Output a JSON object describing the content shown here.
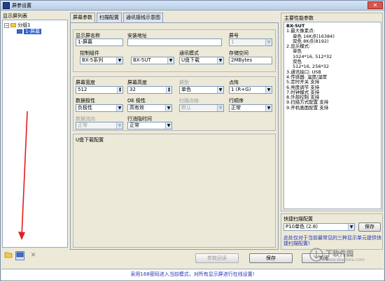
{
  "window": {
    "title": "屏参设置",
    "close_glyph": "✕"
  },
  "left_panel": {
    "title": "显示屏列表",
    "tree": [
      {
        "label": "分组1",
        "expand_glyph": "−"
      },
      {
        "label": "1-屏幕"
      }
    ],
    "tool_icons": [
      "folder-icon",
      "screen-icon",
      "delete-icon"
    ],
    "delete_glyph": "✕"
  },
  "tabs": [
    "屏幕参数",
    "扫描配置",
    "通讯接线示意图"
  ],
  "screen_params": {
    "name_label": "显示屏名称",
    "name_value": "1-屏幕",
    "install_label": "安装地址",
    "install_value": "",
    "number_label": "屏号",
    "number_value": "1",
    "controller_label": "控制组件",
    "series_value": "BX-5系列",
    "model_value": "BX-5UT",
    "comm_label": "通讯模式",
    "comm_value": "U盘下载",
    "storage_label": "存储空间",
    "storage_value": "2MBytes",
    "width_label": "屏幕宽度",
    "width_value": "512",
    "height_label": "屏幕高度",
    "height_value": "32",
    "type_label": "屏型",
    "type_value": "单色",
    "dot_label": "点阵",
    "dot_value": "1 (R+G)",
    "data_pol_label": "数据极性",
    "data_pol_value": "负极性",
    "oe_label": "OE 极性",
    "oe_value": "高有效",
    "scan_label": "扫描点格",
    "scan_value": "默认",
    "row_order_label": "行顺序",
    "row_order_value": "正常",
    "data_dir_label": "数据流向",
    "data_dir_value": "正常",
    "row_blank_label": "行消隐时间",
    "row_blank_value": "正常",
    "usb_label": "U盘下载配置"
  },
  "buttons": {
    "param_readback": "参数回读",
    "save": "保存",
    "close": "关闭"
  },
  "features": {
    "title": "主要性能参数",
    "lines": [
      {
        "text": "BX-5UT",
        "style": "h"
      },
      {
        "text": "1.最大像素点:",
        "style": ""
      },
      {
        "text": "单色 16K点(16384)",
        "style": "ind"
      },
      {
        "text": "双色 8K点(8192)",
        "style": "ind"
      },
      {
        "text": "2.显示模式:",
        "style": ""
      },
      {
        "text": "单色",
        "style": "ind"
      },
      {
        "text": "1024*16, 512*32",
        "style": "ind"
      },
      {
        "text": "双色",
        "style": "ind"
      },
      {
        "text": "512*16, 256*32",
        "style": "ind"
      },
      {
        "text": "3.通讯接口: USB",
        "style": ""
      },
      {
        "text": "4.传感器: 温度/湿度",
        "style": ""
      },
      {
        "text": "5.定时开关 支持",
        "style": ""
      },
      {
        "text": "6.亮度调节 支持",
        "style": ""
      },
      {
        "text": "7.时钟模式 支持",
        "style": ""
      },
      {
        "text": "8.外部控制 支持",
        "style": ""
      },
      {
        "text": "9.扫描方式配置 支持",
        "style": ""
      },
      {
        "text": "9.开机画面配置 支持",
        "style": ""
      }
    ]
  },
  "quick_scan": {
    "title": "快捷扫描配置",
    "value": "P10单色 (2.8)",
    "save": "保存",
    "note": "此处仅对于当前最常见的三种显示单元提供快捷扫描配置!"
  },
  "status_text": "采用168密码进入当前模式，对所有显示屏进行在线设置!",
  "watermark": {
    "text": "下软件园",
    "sub": "www.downxia.com"
  },
  "colors": {
    "annotation_arrow": "#e11d1d",
    "status_text": "#2033b8",
    "selection": "#2f62c9"
  }
}
